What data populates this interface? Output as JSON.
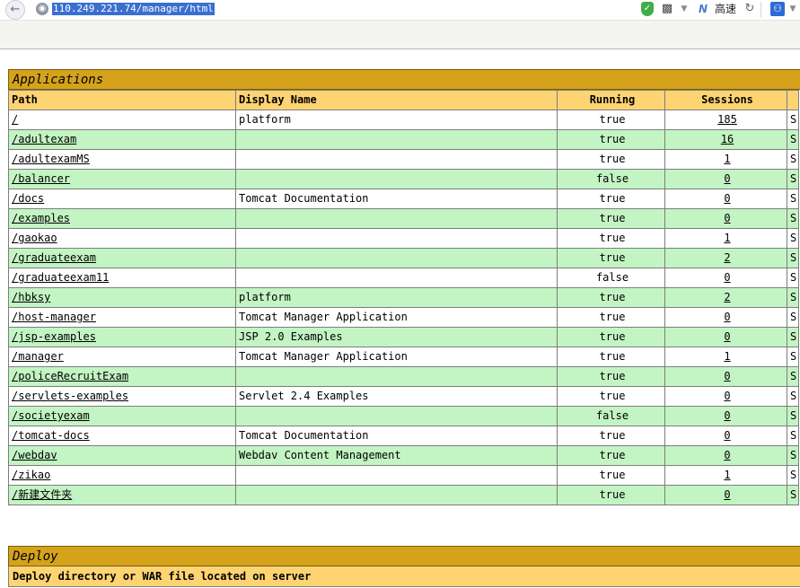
{
  "browser": {
    "url": "110.249.221.74/manager/html",
    "speed_label": "高速",
    "icons": {
      "back": "back-arrow-icon",
      "site": "globe-icon",
      "shield": "shield-icon",
      "qr": "qr-code-icon",
      "speed": "speed-mode-icon",
      "reload": "reload-icon",
      "extension": "paw-icon"
    }
  },
  "applications": {
    "title": "Applications",
    "headers": {
      "path": "Path",
      "display_name": "Display Name",
      "running": "Running",
      "sessions": "Sessions",
      "extra": ""
    },
    "rows": [
      {
        "path": "/",
        "display_name": "platform",
        "running": "true",
        "sessions": "185",
        "extra": "S"
      },
      {
        "path": "/adultexam",
        "display_name": "",
        "running": "true",
        "sessions": "16",
        "extra": "S"
      },
      {
        "path": "/adultexamMS",
        "display_name": "",
        "running": "true",
        "sessions": "1",
        "extra": "S"
      },
      {
        "path": "/balancer",
        "display_name": "",
        "running": "false",
        "sessions": "0",
        "extra": "S"
      },
      {
        "path": "/docs",
        "display_name": "Tomcat Documentation",
        "running": "true",
        "sessions": "0",
        "extra": "S"
      },
      {
        "path": "/examples",
        "display_name": "",
        "running": "true",
        "sessions": "0",
        "extra": "S"
      },
      {
        "path": "/gaokao",
        "display_name": "",
        "running": "true",
        "sessions": "1",
        "extra": "S"
      },
      {
        "path": "/graduateexam",
        "display_name": "",
        "running": "true",
        "sessions": "2",
        "extra": "S"
      },
      {
        "path": "/graduateexam11",
        "display_name": "",
        "running": "false",
        "sessions": "0",
        "extra": "S"
      },
      {
        "path": "/hbksy",
        "display_name": "platform",
        "running": "true",
        "sessions": "2",
        "extra": "S"
      },
      {
        "path": "/host-manager",
        "display_name": "Tomcat Manager Application",
        "running": "true",
        "sessions": "0",
        "extra": "S"
      },
      {
        "path": "/jsp-examples",
        "display_name": "JSP 2.0 Examples",
        "running": "true",
        "sessions": "0",
        "extra": "S"
      },
      {
        "path": "/manager",
        "display_name": "Tomcat Manager Application",
        "running": "true",
        "sessions": "1",
        "extra": "S"
      },
      {
        "path": "/policeRecruitExam",
        "display_name": "",
        "running": "true",
        "sessions": "0",
        "extra": "S"
      },
      {
        "path": "/servlets-examples",
        "display_name": "Servlet 2.4 Examples",
        "running": "true",
        "sessions": "0",
        "extra": "S"
      },
      {
        "path": "/societyexam",
        "display_name": "",
        "running": "false",
        "sessions": "0",
        "extra": "S"
      },
      {
        "path": "/tomcat-docs",
        "display_name": "Tomcat Documentation",
        "running": "true",
        "sessions": "0",
        "extra": "S"
      },
      {
        "path": "/webdav",
        "display_name": "Webdav Content Management",
        "running": "true",
        "sessions": "0",
        "extra": "S"
      },
      {
        "path": "/zikao",
        "display_name": "",
        "running": "true",
        "sessions": "1",
        "extra": "S"
      },
      {
        "path": "/新建文件夹",
        "display_name": "",
        "running": "true",
        "sessions": "0",
        "extra": "S"
      }
    ]
  },
  "deploy": {
    "title": "Deploy",
    "subtitle": "Deploy directory or WAR file located on server"
  },
  "colors": {
    "section_header": "#d5a21b",
    "table_header": "#fed473",
    "row_even": "#c3f4c3",
    "row_odd": "#ffffff"
  }
}
